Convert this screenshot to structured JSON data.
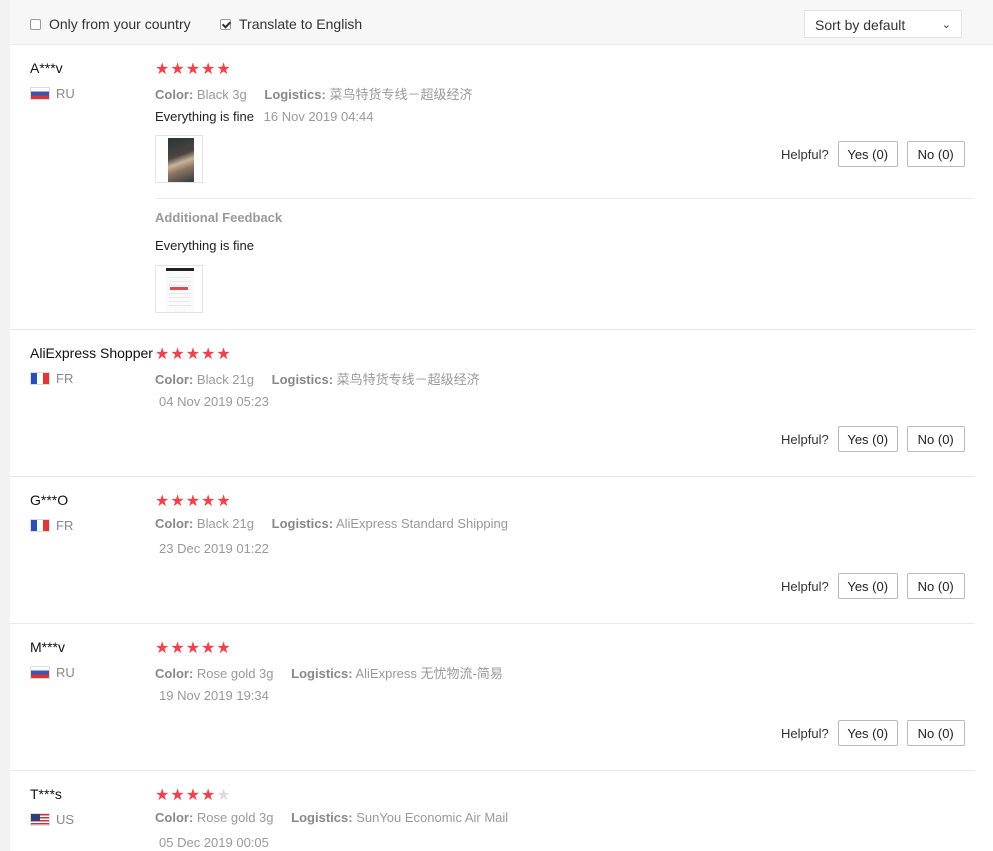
{
  "filters": {
    "only_country": {
      "label": "Only from your country",
      "checked": false
    },
    "translate": {
      "label": "Translate to English",
      "checked": true
    },
    "sort": {
      "label": "Sort by default"
    }
  },
  "helpful_label": "Helpful?",
  "labels": {
    "color": "Color:",
    "logistics": "Logistics:",
    "additional_feedback": "Additional Feedback"
  },
  "colors": {
    "star": "#f0424d",
    "star_empty": "#dddddd"
  },
  "reviews": [
    {
      "user": "A***v",
      "country": "RU",
      "stars": 5,
      "color": "Black 3g",
      "logistics": "菜鸟特货专线－超级经济",
      "text": "Everything is fine",
      "date": "16 Nov 2019 04:44",
      "yes": "Yes (0)",
      "no": "No (0)",
      "additional": {
        "text": "Everything is fine"
      }
    },
    {
      "user": "AliExpress Shopper",
      "country": "FR",
      "stars": 5,
      "color": "Black 21g",
      "logistics": "菜鸟特货专线－超级经济",
      "date": "04 Nov 2019 05:23",
      "yes": "Yes (0)",
      "no": "No (0)"
    },
    {
      "user": "G***O",
      "country": "FR",
      "stars": 5,
      "color": "Black 21g",
      "logistics": "AliExpress Standard Shipping",
      "date": "23 Dec 2019 01:22",
      "yes": "Yes (0)",
      "no": "No (0)"
    },
    {
      "user": "M***v",
      "country": "RU",
      "stars": 5,
      "color": "Rose gold 3g",
      "logistics": "AliExpress 无忧物流-简易",
      "date": "19 Nov 2019 19:34",
      "yes": "Yes (0)",
      "no": "No (0)"
    },
    {
      "user": "T***s",
      "country": "US",
      "stars": 4,
      "color": "Rose gold 3g",
      "logistics": "SunYou Economic Air Mail",
      "date": "05 Dec 2019 00:05"
    }
  ]
}
